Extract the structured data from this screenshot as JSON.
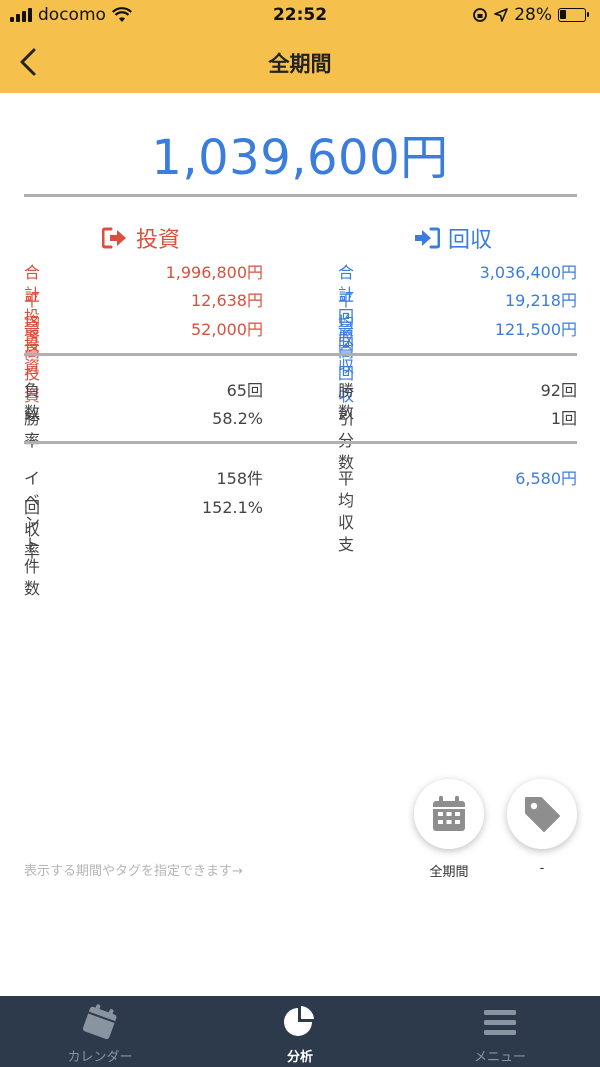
{
  "status_bar": {
    "carrier": "docomo",
    "time": "22:52",
    "battery_percent": "28%",
    "battery_level": 0.28
  },
  "header": {
    "title": "全期間"
  },
  "summary": {
    "total": "1,039,600円"
  },
  "invest": {
    "heading": "投資",
    "rows": [
      {
        "label": "合計投資",
        "value": "1,996,800円"
      },
      {
        "label": "平均投資",
        "value": "12,638円"
      },
      {
        "label": "最高投資",
        "value": "52,000円"
      }
    ]
  },
  "recover": {
    "heading": "回収",
    "rows": [
      {
        "label": "合計回収",
        "value": "3,036,400円"
      },
      {
        "label": "平均回収",
        "value": "19,218円"
      },
      {
        "label": "最高回収",
        "value": "121,500円"
      }
    ]
  },
  "record": {
    "left": [
      {
        "label": "負数",
        "value": "65回"
      },
      {
        "label": "勝率",
        "value": "58.2%"
      }
    ],
    "right": [
      {
        "label": "勝数",
        "value": "92回"
      },
      {
        "label": "引分数",
        "value": "1回"
      }
    ]
  },
  "events": {
    "left": [
      {
        "label": "イベント件数",
        "value": "158件"
      },
      {
        "label": "回収率",
        "value": "152.1%"
      }
    ],
    "right": [
      {
        "label": "平均収支",
        "value": "6,580円"
      }
    ]
  },
  "filters": {
    "hint": "表示する期間やタグを指定できます→",
    "period_label": "全期間",
    "tag_label": "-"
  },
  "tabbar": {
    "calendar": "カレンダー",
    "analysis": "分析",
    "menu": "メニュー"
  },
  "colors": {
    "accent_yellow": "#F6C04C",
    "invest_red": "#D9503E",
    "recover_blue": "#3B7DDD",
    "tabbar_bg": "#2D3A4C"
  }
}
